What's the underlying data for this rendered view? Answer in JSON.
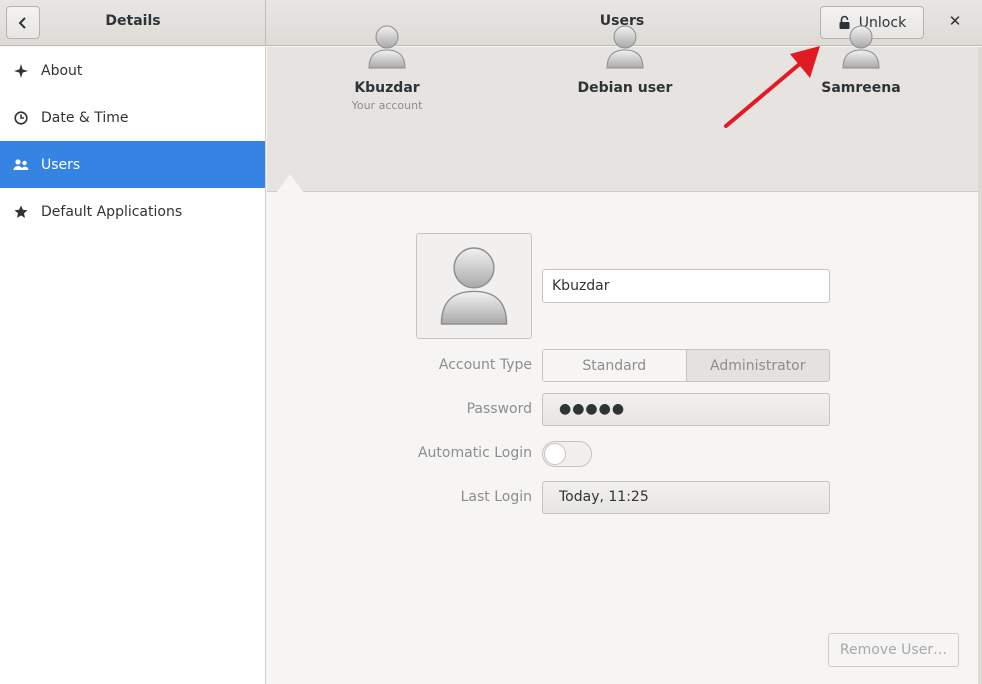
{
  "header": {
    "left_title": "Details",
    "main_title": "Users",
    "unlock_label": "Unlock",
    "close_glyph": "✕"
  },
  "sidebar": {
    "items": [
      {
        "label": "About",
        "icon": "sparkle-icon",
        "active": false
      },
      {
        "label": "Date & Time",
        "icon": "clock-icon",
        "active": false
      },
      {
        "label": "Users",
        "icon": "users-icon",
        "active": true
      },
      {
        "label": "Default Applications",
        "icon": "star-icon",
        "active": false
      }
    ]
  },
  "users": [
    {
      "name": "Kbuzdar",
      "subtitle": "Your account",
      "selected": true
    },
    {
      "name": "Debian user",
      "subtitle": "",
      "selected": false
    },
    {
      "name": "Samreena",
      "subtitle": "",
      "selected": false
    }
  ],
  "details": {
    "full_name": "Kbuzdar",
    "account_type_label": "Account Type",
    "account_type_options": [
      "Standard",
      "Administrator"
    ],
    "account_type_selected": "Administrator",
    "password_label": "Password",
    "password_value": "●●●●●",
    "auto_login_label": "Automatic Login",
    "auto_login_enabled": false,
    "last_login_label": "Last Login",
    "last_login_value": "Today, 11:25",
    "remove_label": "Remove User…"
  },
  "colors": {
    "accent": "#3584e4",
    "annotation_arrow": "#e01b24"
  }
}
